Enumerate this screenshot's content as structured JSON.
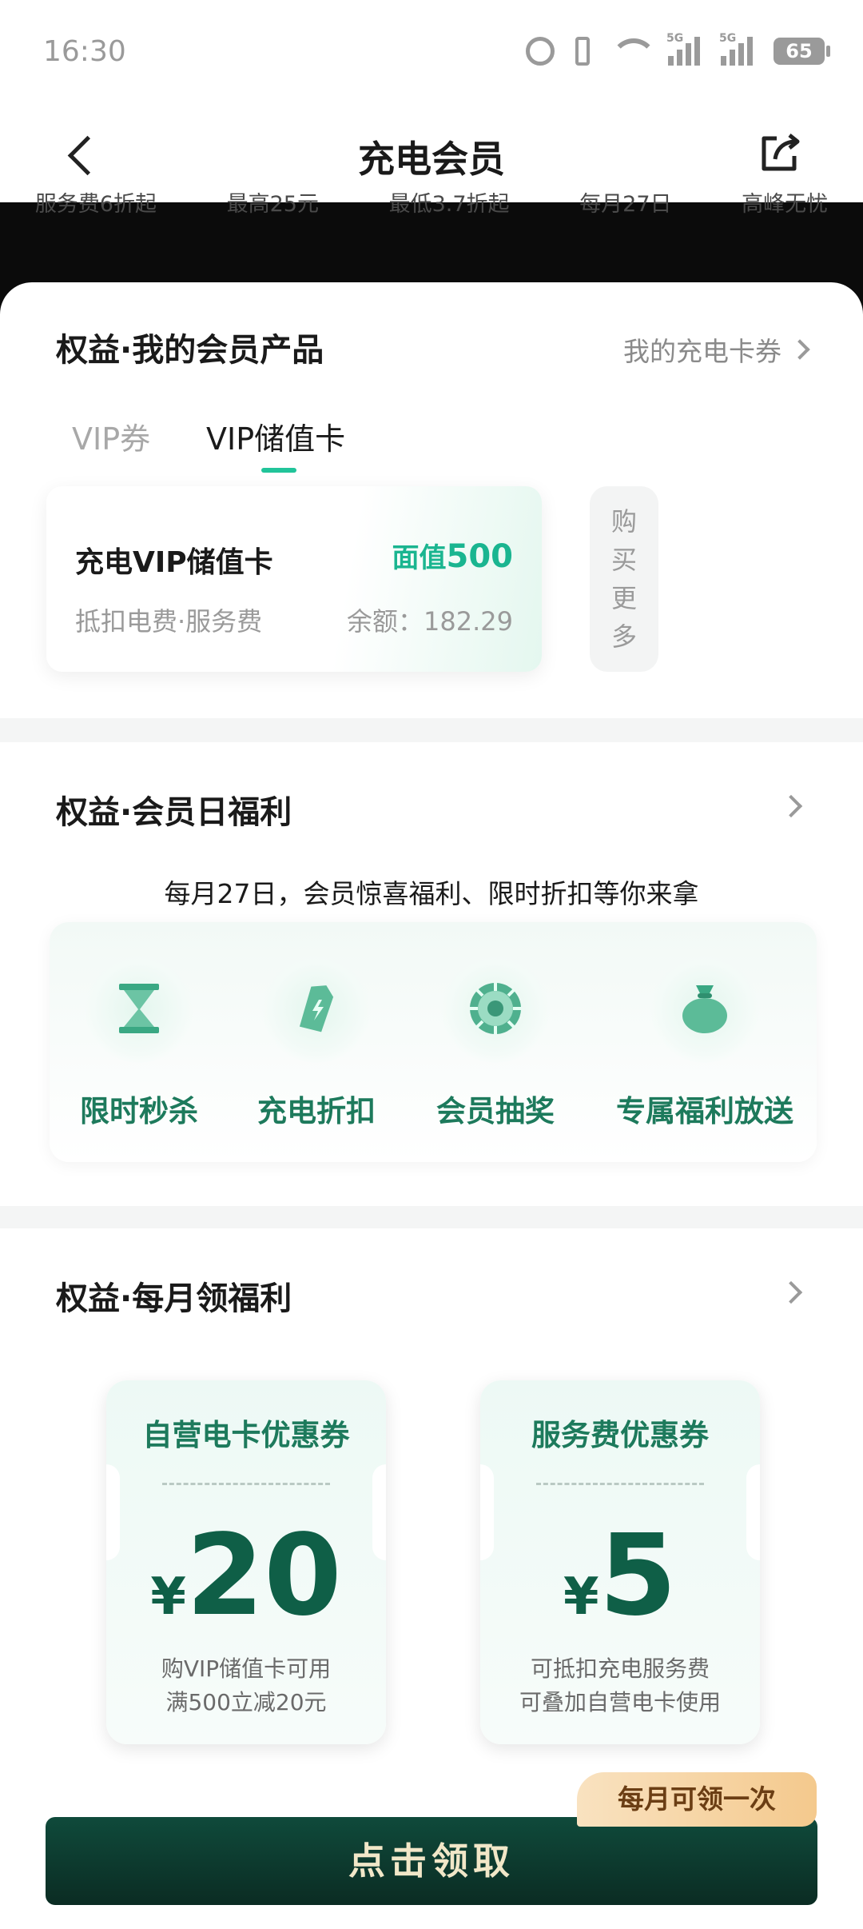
{
  "status_bar": {
    "time": "16:30",
    "battery": "65",
    "signal_labels": [
      "5G",
      "5G"
    ]
  },
  "nav": {
    "title": "充电会员"
  },
  "strip": {
    "items": [
      "服务费6折起",
      "最高25元",
      "最低3.7折起",
      "每月27日",
      "高峰无忧"
    ]
  },
  "my_products": {
    "title": "权益·我的会员产品",
    "link": "我的充电卡券",
    "tabs": [
      "VIP券",
      "VIP储值卡"
    ],
    "card": {
      "name": "充电VIP储值卡",
      "face_prefix": "面值",
      "face_value": "500",
      "desc": "抵扣电费·服务费",
      "balance": "余额：182.29"
    },
    "buy_more": [
      "购",
      "买",
      "更",
      "多"
    ]
  },
  "member_day": {
    "title": "权益·会员日福利",
    "subtitle": "每月27日，会员惊喜福利、限时折扣等你来拿",
    "items": [
      {
        "label": "限时秒杀",
        "icon": "hourglass-icon"
      },
      {
        "label": "充电折扣",
        "icon": "charge-tag-icon"
      },
      {
        "label": "会员抽奖",
        "icon": "lottery-wheel-icon"
      },
      {
        "label": "专属福利放送",
        "icon": "money-bag-icon"
      }
    ]
  },
  "monthly": {
    "title": "权益·每月领福利",
    "coupons": [
      {
        "title": "自营电卡优惠券",
        "currency": "¥",
        "amount": "20",
        "note1": "购VIP储值卡可用",
        "note2": "满500立减20元"
      },
      {
        "title": "服务费优惠券",
        "currency": "¥",
        "amount": "5",
        "note1": "可抵扣充电服务费",
        "note2": "可叠加自营电卡使用"
      }
    ],
    "badge": "每月可领一次",
    "button": "点击领取"
  },
  "colors": {
    "accent": "#21c49a",
    "brand_green": "#1d7a5c",
    "button_dark": "#0f4a3b",
    "badge": "#f4c98d"
  }
}
